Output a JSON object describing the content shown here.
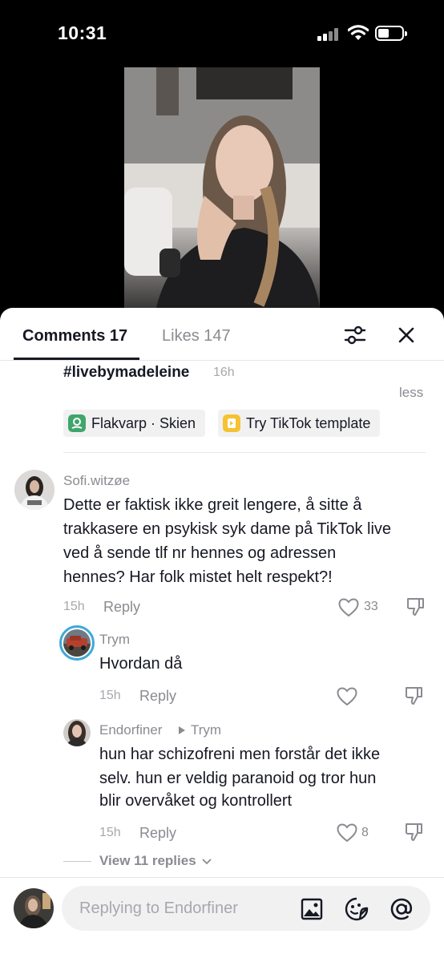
{
  "status_bar": {
    "time": "10:31"
  },
  "tabs": {
    "comments_label": "Comments 17",
    "likes_label": "Likes 147"
  },
  "caption": {
    "hashtag": "#livebymadeleine",
    "time": "16h",
    "less_label": "less",
    "location_chip": "Flakvarp · Skien",
    "template_chip": "Try TikTok template"
  },
  "comment": {
    "username": "Sofi.witzøe",
    "lines": [
      "Dette er faktisk ikke greit lengere, å sitte å",
      "trakkasere en psykisk syk dame på TikTok live",
      "ved å sende tlf nr hennes og adressen",
      "hennes? Har folk mistet helt respekt?!"
    ],
    "time": "15h",
    "reply_label": "Reply",
    "likes": "33"
  },
  "reply1": {
    "username": "Trym",
    "text": "Hvordan då",
    "time": "15h",
    "reply_label": "Reply"
  },
  "reply2": {
    "username": "Endorfiner",
    "reply_to": "Trym",
    "lines": [
      "hun har schizofreni men forstår det ikke",
      "selv. hun er veldig paranoid og tror hun",
      "blir overvåket og kontrollert"
    ],
    "time": "15h",
    "reply_label": "Reply",
    "likes": "8"
  },
  "view_replies_label": "View 11 replies",
  "input": {
    "placeholder": "Replying to Endorfiner"
  },
  "icons": {
    "filter": "sliders-icon",
    "close": "close-icon",
    "location": "map-pin-icon",
    "template": "template-icon",
    "heart": "heart-icon",
    "dislike": "thumbs-down-icon",
    "image": "image-icon",
    "emoji": "sticker-icon",
    "mention": "at-icon"
  },
  "colors": {
    "text": "#161823",
    "secondary": "#8a8b91",
    "location_icon": "#3fa66b",
    "template_icon": "#f5c232"
  }
}
